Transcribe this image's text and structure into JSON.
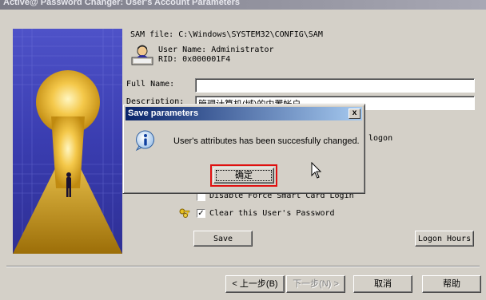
{
  "window": {
    "title": "Active@ Password Changer: User's Account Parameters"
  },
  "account": {
    "sam_file_label": "SAM file:",
    "sam_file_path": "C:\\Windows\\SYSTEM32\\CONFIG\\SAM",
    "user_name_label": "User Name:",
    "user_name": "Administrator",
    "rid_label": "RID:",
    "rid": "0x000001F4"
  },
  "form": {
    "full_name_label": "Full Name:",
    "full_name_value": "",
    "description_label": "Description:",
    "description_value": "管理计算机(域)的内置帐户",
    "hidden_option_fragment": "logon",
    "disable_smart_card_label": "Disable Force Smart Card Login",
    "clear_password_label": "Clear this User's Password",
    "clear_password_checked": true,
    "save_label": "Save",
    "logon_hours_label": "Logon Hours"
  },
  "dialog": {
    "title": "Save parameters",
    "close_glyph": "x",
    "message": "User's attributes has been succesfully changed.",
    "ok_label": "确定",
    "icon": "info-icon"
  },
  "wizard": {
    "back_label": "< 上一步(B)",
    "next_label": "下一步(N) >",
    "cancel_label": "取消",
    "help_label": "帮助"
  },
  "colors": {
    "face": "#d4d0c8",
    "dialog_title_start": "#0a246a",
    "dialog_title_end": "#a6caf0",
    "highlight": "#e01010"
  }
}
